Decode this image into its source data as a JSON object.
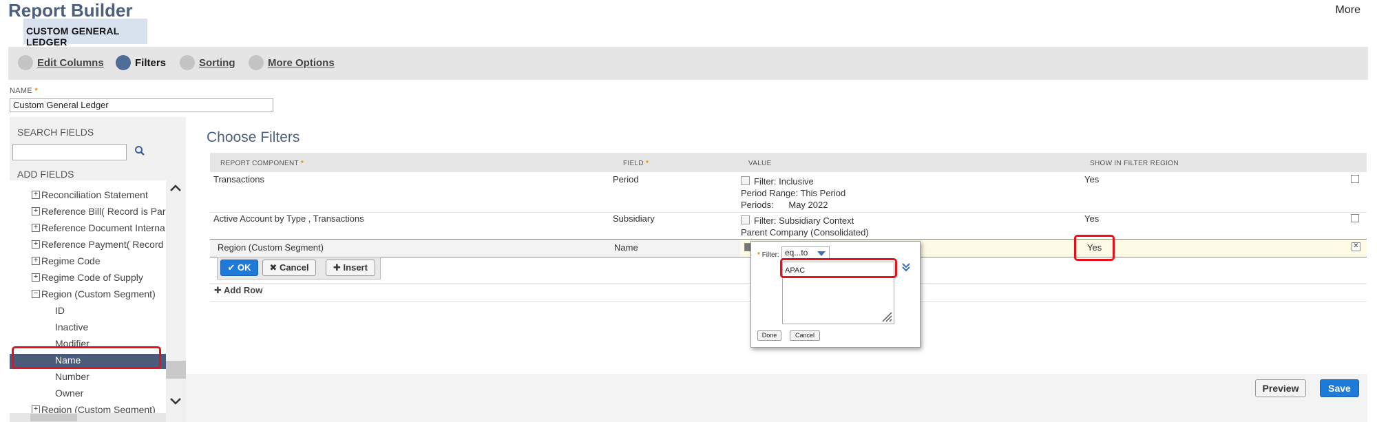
{
  "header": {
    "title": "Report Builder",
    "more": "More",
    "report_tab": "CUSTOM GENERAL LEDGER"
  },
  "steps": [
    {
      "label": "Edit Columns",
      "active": false
    },
    {
      "label": "Filters",
      "active": true
    },
    {
      "label": "Sorting",
      "active": false
    },
    {
      "label": "More Options",
      "active": false
    }
  ],
  "name_field": {
    "label": "NAME",
    "required": "*",
    "value": "Custom General Ledger"
  },
  "left_panel": {
    "search_label": "SEARCH FIELDS",
    "search_value": "",
    "add_label": "ADD FIELDS",
    "items": [
      {
        "label": "Reconciliation Statement",
        "expandable": true
      },
      {
        "label": "Reference Bill( Record is Pare",
        "expandable": true
      },
      {
        "label": "Reference Document Interna",
        "expandable": true
      },
      {
        "label": "Reference Payment( Record is",
        "expandable": true
      },
      {
        "label": "Regime Code",
        "expandable": true
      },
      {
        "label": "Regime Code of Supply",
        "expandable": true
      },
      {
        "label": "Region (Custom Segment)",
        "expandable": true,
        "expanded": true
      },
      {
        "label": "ID",
        "child": true
      },
      {
        "label": "Inactive",
        "child": true
      },
      {
        "label": "Modifier",
        "child": true
      },
      {
        "label": "Name",
        "child": true,
        "selected": true
      },
      {
        "label": "Number",
        "child": true
      },
      {
        "label": "Owner",
        "child": true
      },
      {
        "label": "Region (Custom Segment)",
        "expandable": true
      }
    ]
  },
  "main": {
    "title": "Choose Filters",
    "columns": {
      "component": "REPORT COMPONENT",
      "field": "FIELD",
      "value": "VALUE",
      "show": "SHOW IN FILTER REGION"
    },
    "rows": [
      {
        "component": "Transactions",
        "field": "Period",
        "value_line1": "Filter: Inclusive",
        "value_line2": "Period Range: This Period",
        "value_line3": "Periods:      May 2022",
        "show": "Yes"
      },
      {
        "component": "Active Account by Type , Transactions",
        "field": "Subsidiary",
        "value_line1": "Filter: Subsidiary Context",
        "value_line2": "Parent Company (Consolidated)",
        "show": "Yes"
      }
    ],
    "edit_row": {
      "component": "Region (Custom Segment)",
      "field": "Name",
      "show": "Yes"
    },
    "edit_buttons": {
      "ok": "OK",
      "cancel": "Cancel",
      "insert": "Insert"
    },
    "add_row": "Add Row"
  },
  "popup": {
    "filter_label": "Filter:",
    "filter_value": "eq...to",
    "text_value": "APAC",
    "done": "Done",
    "cancel": "Cancel"
  },
  "footer": {
    "preview": "Preview",
    "save": "Save"
  },
  "colors": {
    "title": "#4d5f7f",
    "accent_blue": "#1e7ad9",
    "highlight": "#e8101a",
    "selected_row": "#4b5c7a"
  }
}
